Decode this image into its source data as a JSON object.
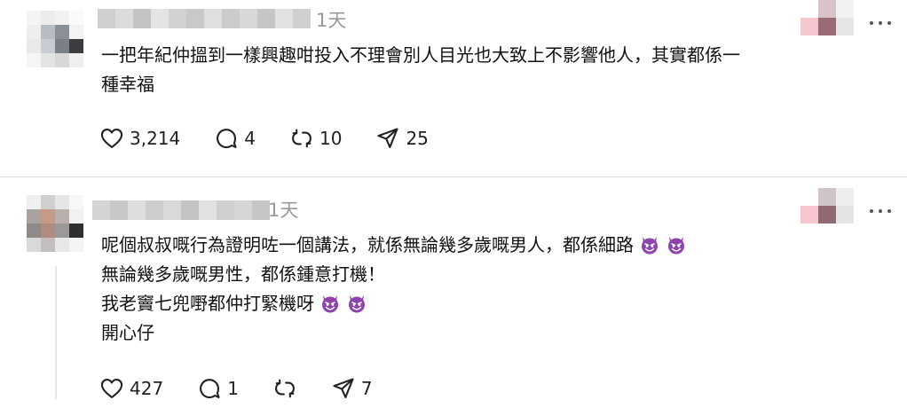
{
  "post1": {
    "time": "1天",
    "lines": [
      "一把年紀仲搵到一樣興趣咁投入不理會別人目光也大致上不影響他人，其實都係一",
      "種幸福"
    ],
    "likes": "3,214",
    "comments": "4",
    "reposts": "10",
    "shares": "25"
  },
  "post2": {
    "time": "1天",
    "lines": [
      "呢個叔叔嘅行為證明咗一個講法，就係無論幾多歲嘅男人，都係細路",
      "無論幾多歲嘅男性，都係鍾意打機！",
      "我老竇七兜嘢都仲打緊機呀",
      "開心仔"
    ],
    "likes": "427",
    "comments": "1",
    "shares": "7"
  },
  "icons": {
    "like": "heart-icon",
    "comment": "speech-bubble-icon",
    "repost": "repost-icon",
    "share": "send-icon",
    "more": "more-dots-icon",
    "emoji": "smiling-devil-emoji"
  },
  "colors": {
    "muted_text": "#999999",
    "icon": "#222222",
    "devil": "#8e44ad",
    "divider": "#e0e0e0"
  }
}
